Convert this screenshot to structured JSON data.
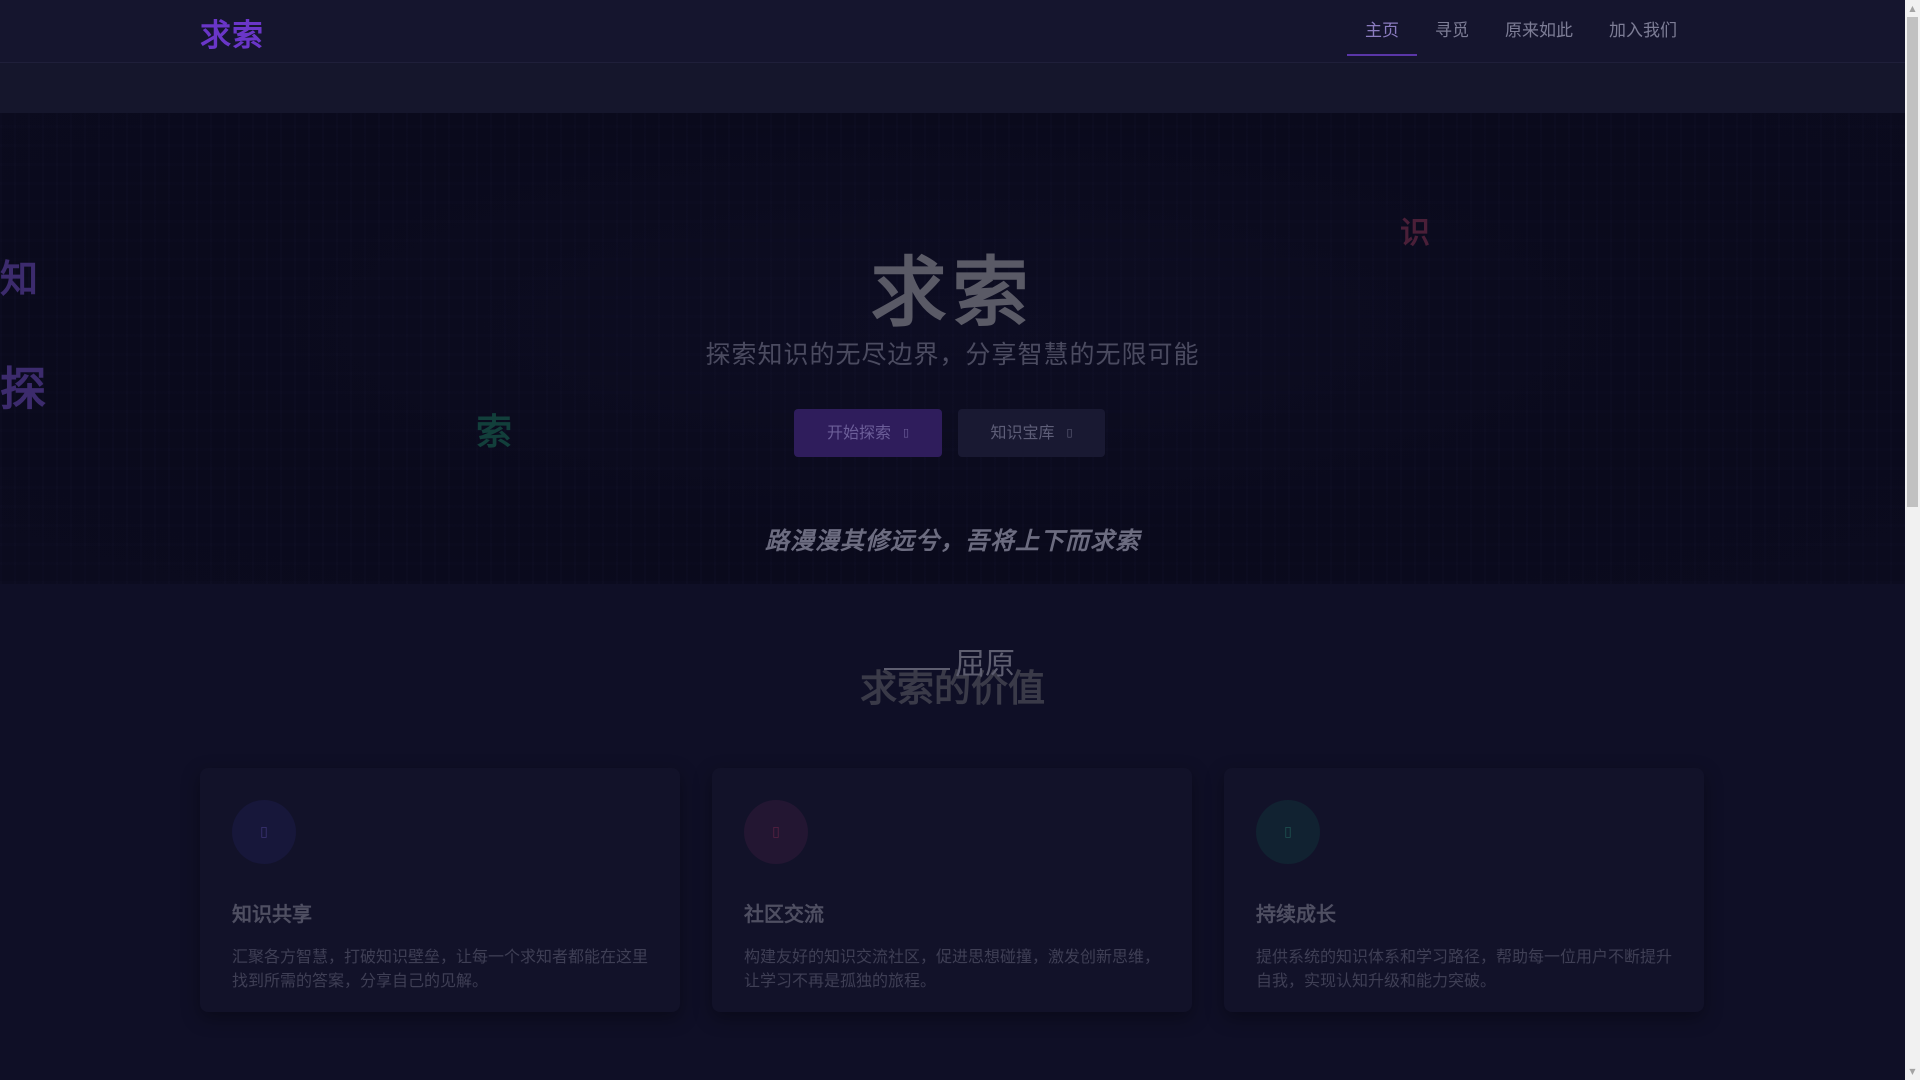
{
  "brand": "求索",
  "nav": {
    "items": [
      "主页",
      "寻觅",
      "原来如此",
      "加入我们"
    ],
    "active_index": 0
  },
  "hero": {
    "floating_chars": [
      "知",
      "探",
      "索",
      "识"
    ],
    "title": "求索",
    "subtitle": "探索知识的无尽边界，分享智慧的无限可能",
    "primary_button": "开始探索",
    "secondary_button": "知识宝库",
    "quote": "路漫漫其修远兮，吾将上下而求索"
  },
  "section": {
    "author": "屈原",
    "title": "求索的价值"
  },
  "cards": [
    {
      "title": "知识共享",
      "text": "汇聚各方智慧，打破知识壁垒，让每一个求知者都能在这里找到所需的答案，分享自己的见解。",
      "icon": "book-icon",
      "accent": "#3d3475"
    },
    {
      "title": "社区交流",
      "text": "构建友好的知识交流社区，促进思想碰撞，激发创新思维，让学习不再是孤独的旅程。",
      "icon": "users-icon",
      "accent": "#5a2242"
    },
    {
      "title": "持续成长",
      "text": "提供系统的知识体系和学习路径，帮助每一位用户不断提升自我，实现认知升级和能力突破。",
      "icon": "growth-icon",
      "accent": "#1f5452"
    }
  ],
  "colors": {
    "brand": "#6a36c8",
    "primary_button": "#2f1d5c",
    "background": "#11112b"
  }
}
